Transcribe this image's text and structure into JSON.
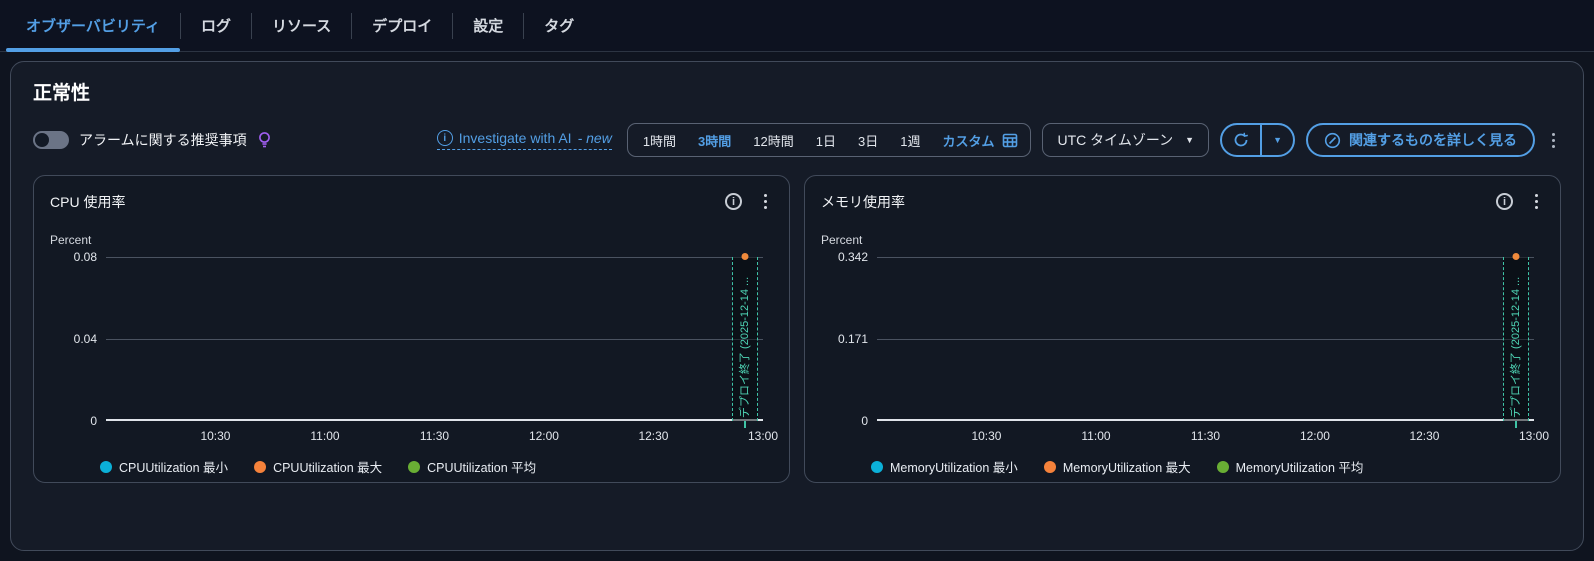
{
  "colors": {
    "accent_blue": "#539fe5",
    "annotation_teal": "#3fc4a6",
    "annotation_dot_orange": "#f08a3c",
    "legend_min_blue": "#0bb0d8",
    "legend_max_orange": "#f5823b",
    "legend_avg_green": "#69ae34"
  },
  "tabs": {
    "items": [
      {
        "label": "オブザーバビリティ",
        "active": true
      },
      {
        "label": "ログ",
        "active": false
      },
      {
        "label": "リソース",
        "active": false
      },
      {
        "label": "デプロイ",
        "active": false
      },
      {
        "label": "設定",
        "active": false
      },
      {
        "label": "タグ",
        "active": false
      }
    ]
  },
  "panel": {
    "title": "正常性",
    "alarm_toggle": {
      "label": "アラームに関する推奨事項",
      "state": "off"
    },
    "investigate": {
      "label": "Investigate with AI",
      "suffix": "- new"
    },
    "time_ranges": {
      "options": [
        "1時間",
        "3時間",
        "12時間",
        "1日",
        "3日",
        "1週",
        "カスタム"
      ],
      "selected": "3時間"
    },
    "timezone_button": "UTC タイムゾーン",
    "explore_button": "関連するものを詳しく見る"
  },
  "charts": [
    {
      "title": "CPU 使用率",
      "unit": "Percent",
      "yticks": [
        "0.08",
        "0.04",
        "0"
      ],
      "xticks": [
        "10:30",
        "11:00",
        "11:30",
        "12:00",
        "12:30",
        "13:00"
      ],
      "legend": [
        {
          "label": "CPUUtilization 最小",
          "color": "#0bb0d8"
        },
        {
          "label": "CPUUtilization 最大",
          "color": "#f5823b"
        },
        {
          "label": "CPUUtilization 平均",
          "color": "#69ae34"
        }
      ],
      "annotation": {
        "text": "デプロイ終了 (2025-12-14 ...",
        "time": "13:00"
      },
      "chart_data": {
        "type": "line",
        "title": "CPU 使用率",
        "ylabel": "Percent",
        "ylim": [
          0,
          0.08
        ],
        "x": [
          "10:30",
          "11:00",
          "11:30",
          "12:00",
          "12:30",
          "13:00"
        ],
        "series": [
          {
            "name": "CPUUtilization 最小",
            "values": [
              0,
              0,
              0,
              0,
              0,
              0
            ]
          },
          {
            "name": "CPUUtilization 最大",
            "values": [
              0,
              0,
              0,
              0,
              0,
              0.08
            ]
          },
          {
            "name": "CPUUtilization 平均",
            "values": [
              0,
              0,
              0,
              0,
              0,
              0
            ]
          }
        ],
        "annotations": [
          {
            "type": "vertical-band",
            "x": "13:00",
            "label": "デプロイ終了 (2025-12-14 ..."
          }
        ],
        "legend_position": "bottom",
        "grid": true
      }
    },
    {
      "title": "メモリ使用率",
      "unit": "Percent",
      "yticks": [
        "0.342",
        "0.171",
        "0"
      ],
      "xticks": [
        "10:30",
        "11:00",
        "11:30",
        "12:00",
        "12:30",
        "13:00"
      ],
      "legend": [
        {
          "label": "MemoryUtilization 最小",
          "color": "#0bb0d8"
        },
        {
          "label": "MemoryUtilization 最大",
          "color": "#f5823b"
        },
        {
          "label": "MemoryUtilization 平均",
          "color": "#69ae34"
        }
      ],
      "annotation": {
        "text": "デプロイ終了 (2025-12-14 ...",
        "time": "13:00"
      },
      "chart_data": {
        "type": "line",
        "title": "メモリ使用率",
        "ylabel": "Percent",
        "ylim": [
          0,
          0.342
        ],
        "x": [
          "10:30",
          "11:00",
          "11:30",
          "12:00",
          "12:30",
          "13:00"
        ],
        "series": [
          {
            "name": "MemoryUtilization 最小",
            "values": [
              0,
              0,
              0,
              0,
              0,
              0
            ]
          },
          {
            "name": "MemoryUtilization 最大",
            "values": [
              0,
              0,
              0,
              0,
              0,
              0.342
            ]
          },
          {
            "name": "MemoryUtilization 平均",
            "values": [
              0,
              0,
              0,
              0,
              0,
              0
            ]
          }
        ],
        "annotations": [
          {
            "type": "vertical-band",
            "x": "13:00",
            "label": "デプロイ終了 (2025-12-14 ..."
          }
        ],
        "legend_position": "bottom",
        "grid": true
      }
    }
  ]
}
